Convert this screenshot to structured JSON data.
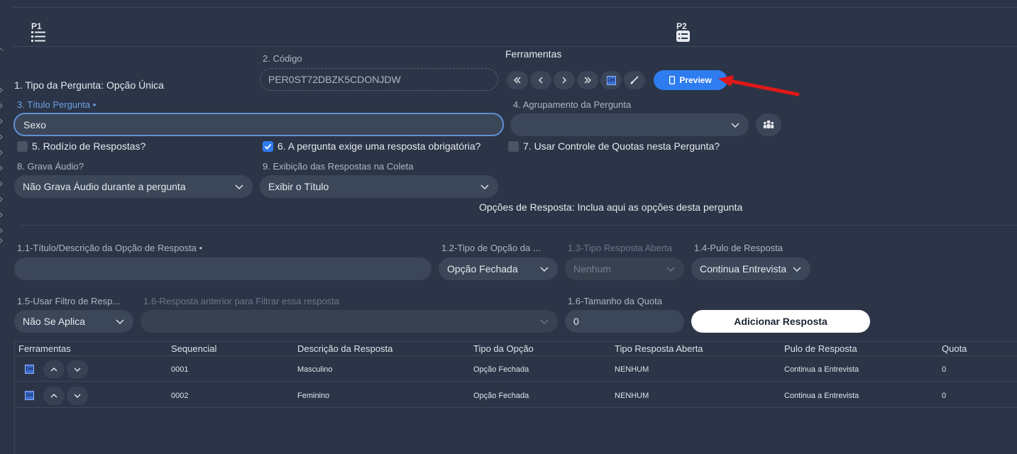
{
  "header": {
    "p1_label": "P1",
    "p2_label": "P2"
  },
  "fields": {
    "tipo_pergunta": "1. Tipo da Pergunta: Opção Única",
    "codigo_label": "2. Código",
    "codigo_value": "PER0ST72DBZK5CDONJDW",
    "titulo_label": "3. Título Pergunta •",
    "titulo_value": "Sexo",
    "agrupamento_label": "4. Agrupamento da Pergunta",
    "agrupamento_value": "",
    "rodizio_label": "5. Rodízio de Respostas?",
    "obrigatoria_label": "6. A pergunta exige uma resposta obrigatória?",
    "quotas_label": "7. Usar Controle de Quotas nesta Pergunta?",
    "grava_audio_label": "8. Grava Áudio?",
    "grava_audio_value": "Não Grava Áudio durante a pergunta",
    "exibicao_label": "9. Exibição das Respostas na Coleta",
    "exibicao_value": "Exibir o Título"
  },
  "tools": {
    "title": "Ferramentas",
    "del_label": "Del",
    "preview_label": "Preview"
  },
  "options_section": {
    "title": "Opções de Resposta: Inclua aqui as opções desta pergunta",
    "desc_label": "1.1-Título/Descrição da Opção de Resposta •",
    "desc_value": "",
    "tipo_label": "1.2-Tipo de Opção da ...",
    "tipo_value": "Opção Fechada",
    "tipo_aberta_label": "1.3-Tipo Resposta Aberta",
    "tipo_aberta_value": "Nenhum",
    "pulo_label": "1.4-Pulo de Resposta",
    "pulo_value": "Continua Entrevista",
    "filtro_label": "1.5-Usar Filtro de Resp...",
    "filtro_value": "Não Se Aplica",
    "anterior_label": "1.6-Resposta anterior para Filtrar essa resposta",
    "anterior_value": "",
    "quota_label": "1.6-Tamanho da Quota",
    "quota_value": "0",
    "add_button": "Adicionar Resposta"
  },
  "table": {
    "headers": [
      "Ferramentas",
      "Sequencial",
      "Descrição da Resposta",
      "Tipo da Opção",
      "Tipo Resposta Aberta",
      "Pulo de Resposta",
      "Quota"
    ],
    "rows": [
      {
        "del": "Del",
        "seq": "0001",
        "desc": "Masculino",
        "tipo": "Opção Fechada",
        "aberta": "NENHUM",
        "pulo": "Continua a Entrevista",
        "quota": "0"
      },
      {
        "del": "Del",
        "seq": "0002",
        "desc": "Feminino",
        "tipo": "Opção Fechada",
        "aberta": "NENHUM",
        "pulo": "Continua a Entrevista",
        "quota": "0"
      }
    ]
  },
  "colors": {
    "background": "#2b3547",
    "field": "#3b4658",
    "accent": "#2f7cf0",
    "arrow": "#e01818"
  }
}
